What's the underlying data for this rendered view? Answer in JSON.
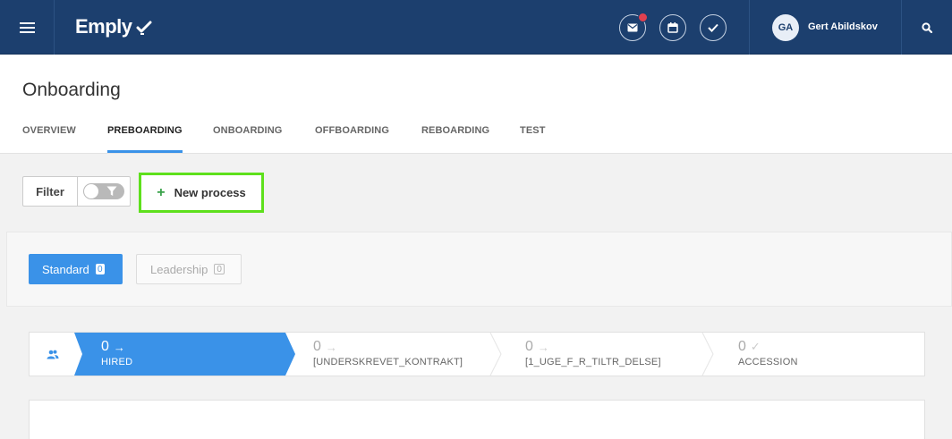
{
  "app": {
    "logo_text": "Emply",
    "user_initials": "GA",
    "user_name": "Gert Abildskov"
  },
  "icons": {
    "menu": "hamburger-icon",
    "mail": "mail-icon",
    "calendar": "calendar-icon",
    "tasks": "check-icon",
    "search": "search-icon",
    "people": "people-icon"
  },
  "colors": {
    "topbar": "#1c3f6e",
    "accent": "#3a92e8",
    "highlight": "#5ee01c",
    "notification": "#e0404f"
  },
  "page": {
    "title": "Onboarding"
  },
  "tabs": [
    {
      "label": "OVERVIEW",
      "active": false
    },
    {
      "label": "PREBOARDING",
      "active": true
    },
    {
      "label": "ONBOARDING",
      "active": false
    },
    {
      "label": "OFFBOARDING",
      "active": false
    },
    {
      "label": "REBOARDING",
      "active": false
    },
    {
      "label": "TEST",
      "active": false
    }
  ],
  "toolbar": {
    "filter_label": "Filter",
    "filter_enabled": false,
    "new_process_icon": "+",
    "new_process_label": "New process"
  },
  "templates": [
    {
      "label": "Standard",
      "count": "0",
      "active": true
    },
    {
      "label": "Leadership",
      "count": "0",
      "active": false
    }
  ],
  "stages": [
    {
      "count": "0",
      "label": "HIRED",
      "symbol": "→",
      "active": true
    },
    {
      "count": "0",
      "label": "[UNDERSKREVET_KONTRAKT]",
      "symbol": "→",
      "active": false
    },
    {
      "count": "0",
      "label": "[1_UGE_F_R_TILTR_DELSE]",
      "symbol": "→",
      "active": false
    },
    {
      "count": "0",
      "label": "ACCESSION",
      "symbol": "✓",
      "active": false
    }
  ]
}
